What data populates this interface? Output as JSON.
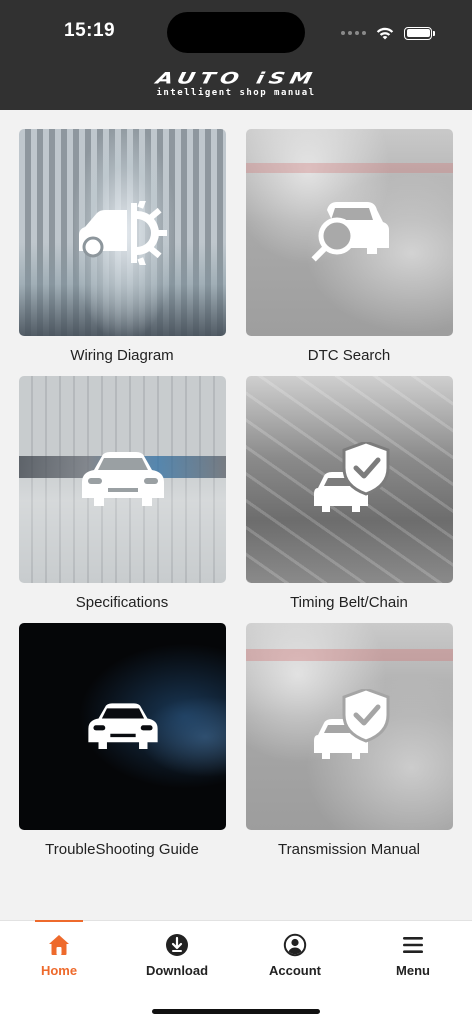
{
  "status_bar": {
    "time": "15:19"
  },
  "header": {
    "logo_main": "AUTO iSM",
    "logo_sub": "intelligent shop manual"
  },
  "tiles": [
    {
      "label": "Wiring Diagram",
      "icon": "car-gear-icon"
    },
    {
      "label": "DTC Search",
      "icon": "car-search-icon"
    },
    {
      "label": "Specifications",
      "icon": "car-icon"
    },
    {
      "label": "Timing Belt/Chain",
      "icon": "car-shield-icon"
    },
    {
      "label": "TroubleShooting Guide",
      "icon": "car-icon"
    },
    {
      "label": "Transmission Manual",
      "icon": "car-shield-icon"
    }
  ],
  "tabbar": {
    "active": "Home",
    "accent_color": "#ee6a2c",
    "items": [
      {
        "label": "Home",
        "icon": "home-icon"
      },
      {
        "label": "Download",
        "icon": "download-icon"
      },
      {
        "label": "Account",
        "icon": "account-icon"
      },
      {
        "label": "Menu",
        "icon": "menu-icon"
      }
    ]
  }
}
